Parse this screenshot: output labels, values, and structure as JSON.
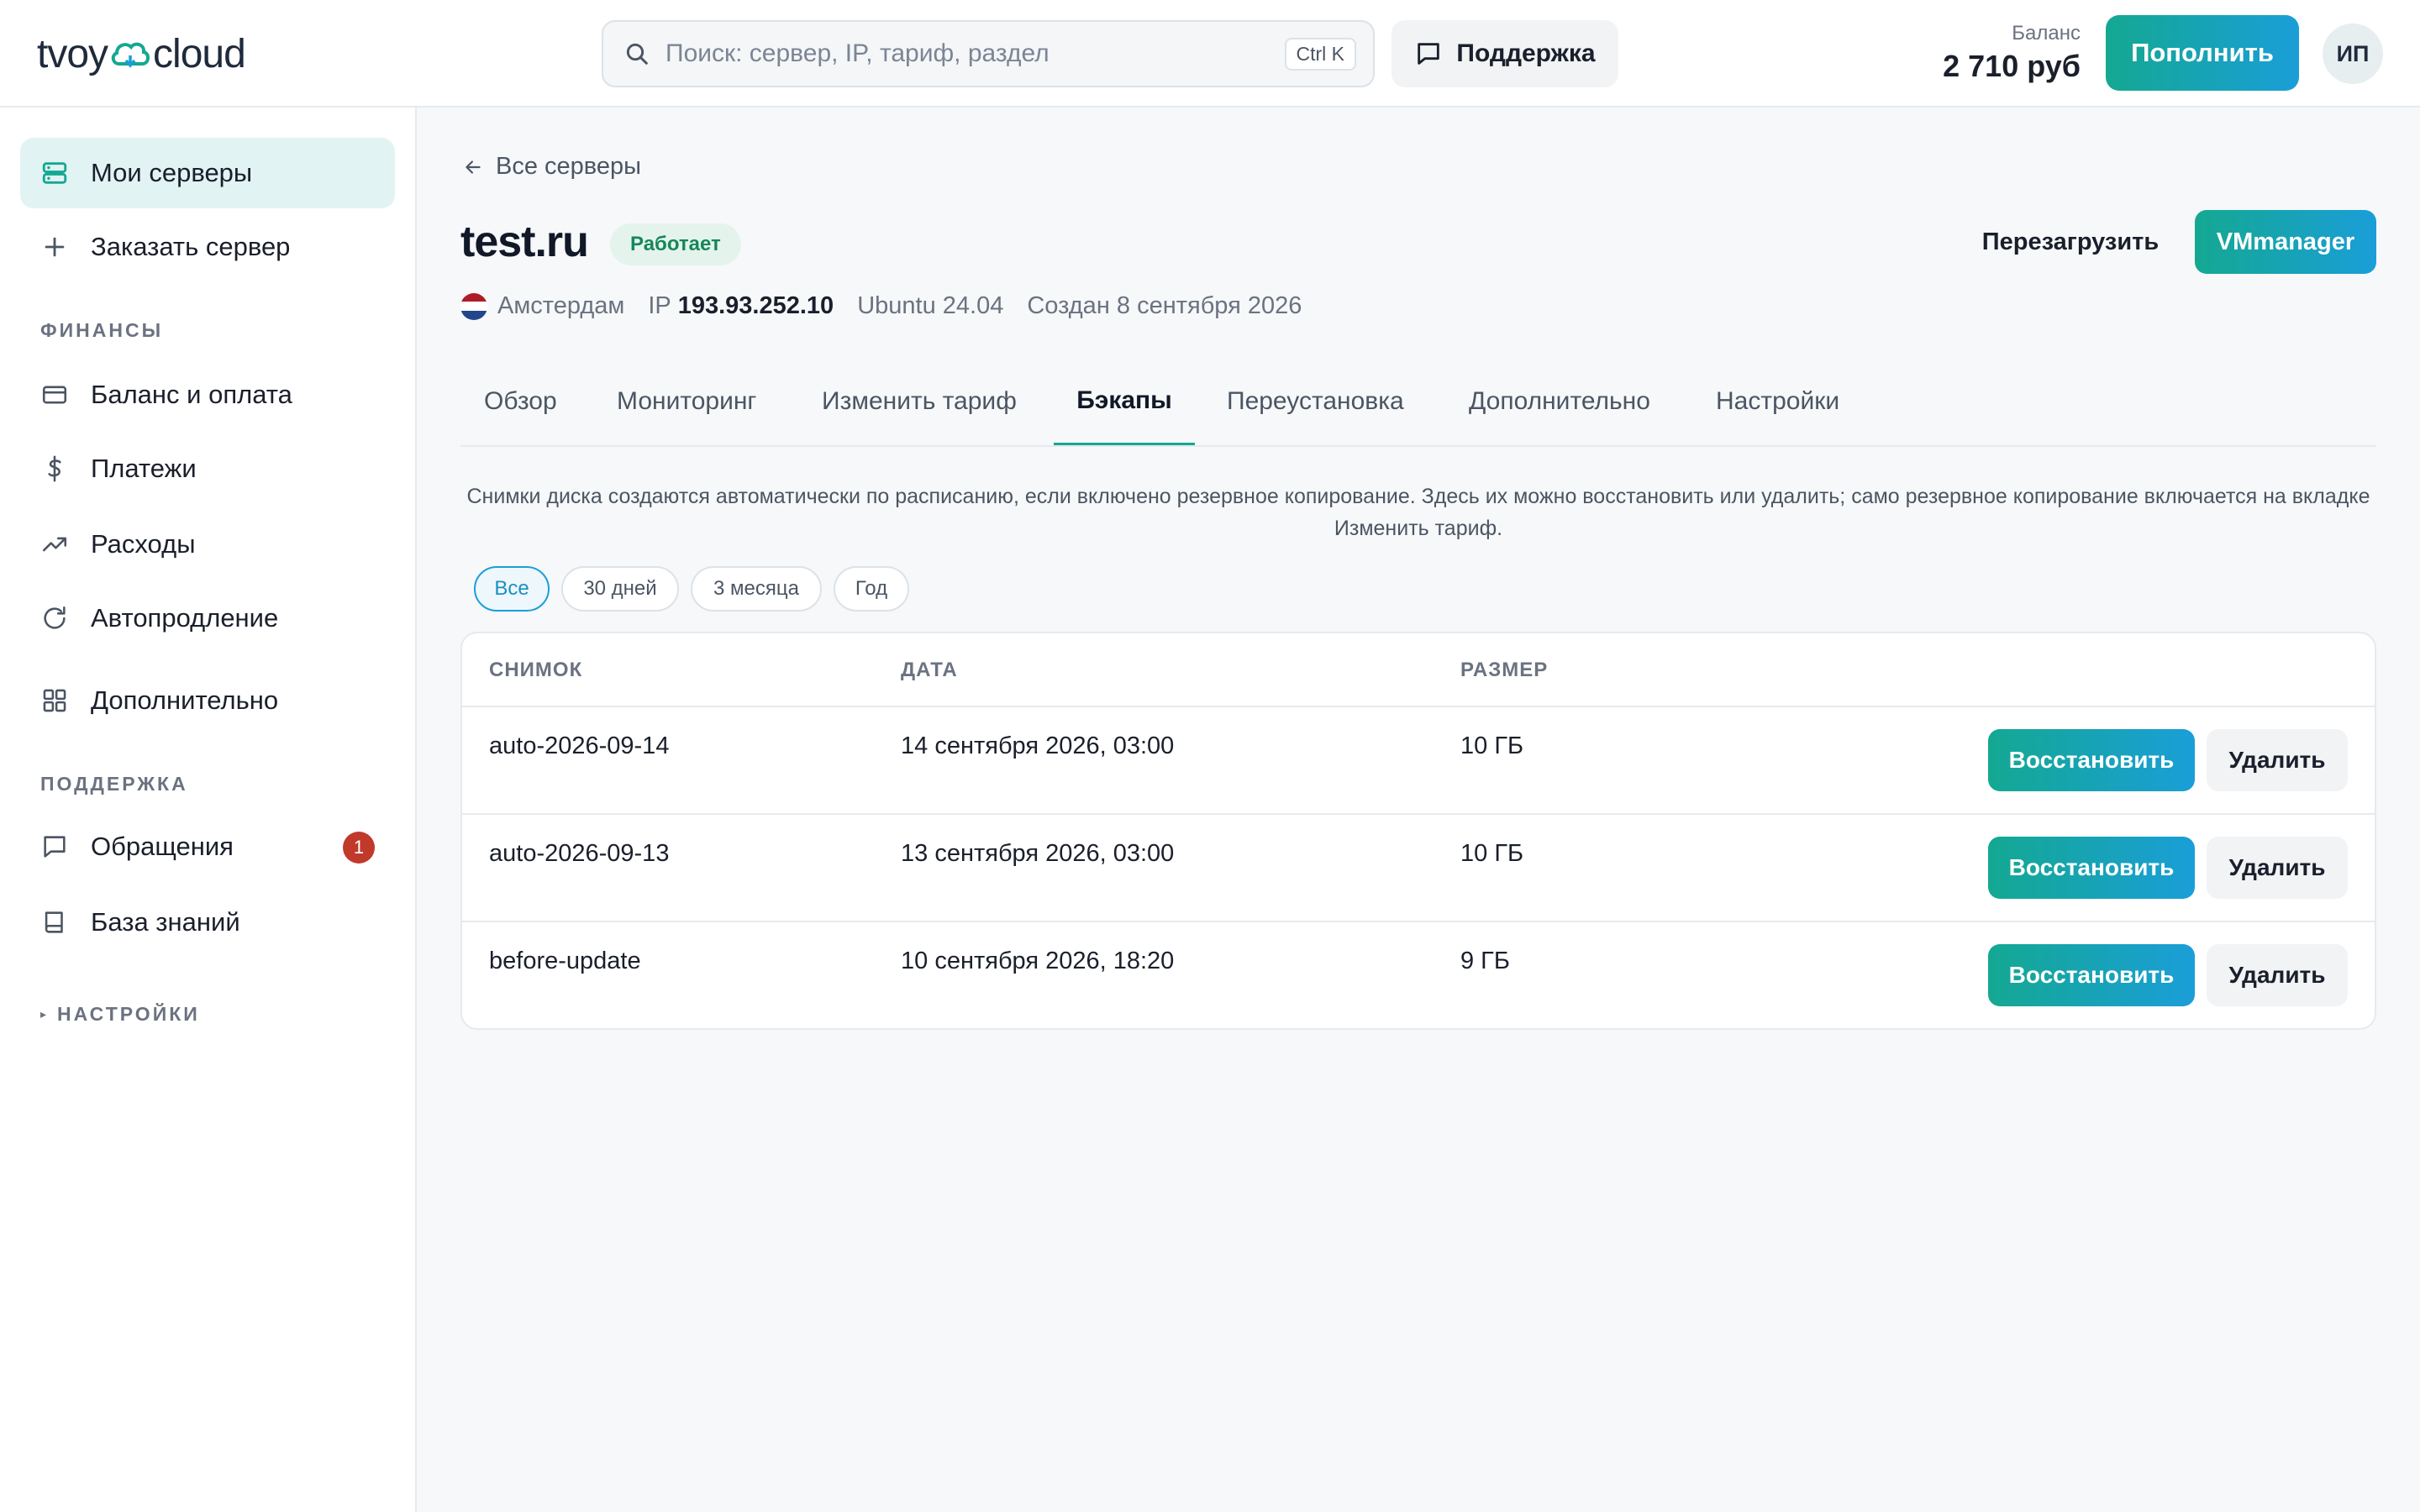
{
  "brand": {
    "part1": "tvoy",
    "part2": "cloud",
    "accent": "#14a892"
  },
  "search": {
    "placeholder": "Поиск: сервер, IP, тариф, раздел",
    "shortcut": "Ctrl K"
  },
  "header": {
    "support_label": "Поддержка",
    "balance_label": "Баланс",
    "balance_value": "2 710 руб",
    "topup_label": "Пополнить",
    "avatar_initials": "ИП"
  },
  "sidebar": {
    "items_main": [
      {
        "label": "Мои серверы",
        "icon": "server-icon",
        "active": true
      },
      {
        "label": "Заказать сервер",
        "icon": "plus-icon"
      }
    ],
    "section_finance": "ФИНАНСЫ",
    "items_finance": [
      {
        "label": "Баланс и оплата",
        "icon": "credit-card-icon"
      },
      {
        "label": "Платежи",
        "icon": "dollar-icon"
      },
      {
        "label": "Расходы",
        "icon": "trend-icon"
      },
      {
        "label": "Автопродление",
        "icon": "refresh-icon"
      },
      {
        "label": "Дополнительно",
        "icon": "grid-icon"
      }
    ],
    "section_support": "ПОДДЕРЖКА",
    "items_support": [
      {
        "label": "Обращения",
        "icon": "chat-icon",
        "badge": "1"
      },
      {
        "label": "База знаний",
        "icon": "book-icon"
      }
    ],
    "section_settings": "НАСТРОЙКИ"
  },
  "server": {
    "back_label": "Все серверы",
    "name": "test.ru",
    "status": "Работает",
    "reboot_label": "Перезагрузить",
    "panel_label": "VMmanager",
    "location": "Амстердам",
    "ip_label": "IP",
    "ip": "193.93.252.10",
    "os": "Ubuntu 24.04",
    "created": "Создан 8 сентября 2026"
  },
  "tabs": [
    "Обзор",
    "Мониторинг",
    "Изменить тариф",
    "Бэкапы",
    "Переустановка",
    "Дополнительно",
    "Настройки"
  ],
  "active_tab": "Бэкапы",
  "backups": {
    "description": "Снимки диска создаются автоматически по расписанию, если включено резервное копирование. Здесь их можно восстановить или удалить; само резервное копирование включается на вкладке Изменить тариф.",
    "filters": [
      "Все",
      "30 дней",
      "3 месяца",
      "Год"
    ],
    "active_filter": "Все",
    "columns": [
      "СНИМОК",
      "ДАТА",
      "РАЗМЕР"
    ],
    "rows": [
      {
        "name": "auto-2026-09-14",
        "date": "14 сентября 2026, 03:00",
        "size": "10 ГБ"
      },
      {
        "name": "auto-2026-09-13",
        "date": "13 сентября 2026, 03:00",
        "size": "10 ГБ"
      },
      {
        "name": "before-update",
        "date": "10 сентября 2026, 18:20",
        "size": "9 ГБ"
      }
    ],
    "restore_label": "Восстановить",
    "delete_label": "Удалить"
  }
}
